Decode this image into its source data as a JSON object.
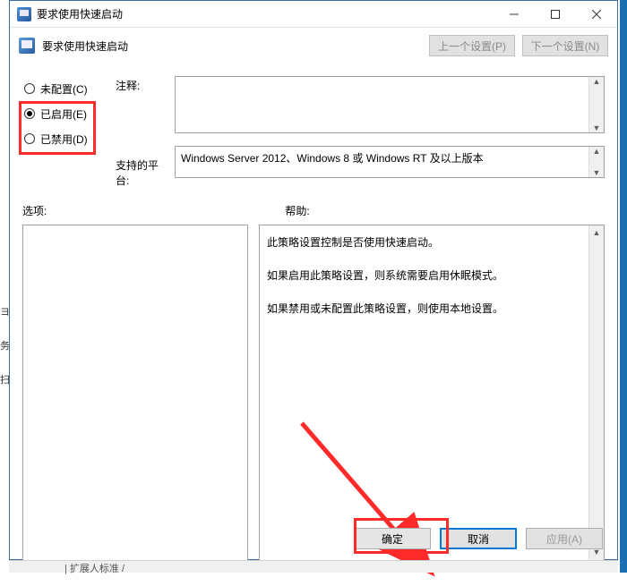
{
  "titlebar": {
    "title": "要求使用快速启动"
  },
  "toolbar": {
    "subtitle": "要求使用快速启动",
    "prev": "上一个设置(P)",
    "next": "下一个设置(N)"
  },
  "radios": {
    "not_configured": "未配置(C)",
    "enabled": "已启用(E)",
    "disabled": "已禁用(D)",
    "selected": "enabled"
  },
  "labels": {
    "comment": "注释:",
    "platform": "支持的平台:",
    "options": "选项:",
    "help": "帮助:"
  },
  "platform_text": "Windows Server 2012、Windows 8 或 Windows RT 及以上版本",
  "help_text": {
    "p1": "此策略设置控制是否使用快速启动。",
    "p2": "如果启用此策略设置，则系统需要启用休眠模式。",
    "p3": "如果禁用或未配置此策略设置，则使用本地设置。"
  },
  "buttons": {
    "ok": "确定",
    "cancel": "取消",
    "apply": "应用(A)"
  },
  "bottom_fragment": "| 扩展人标准 /",
  "left_fragments": {
    "a": "ヨ",
    "b": "务",
    "c": "扫"
  }
}
